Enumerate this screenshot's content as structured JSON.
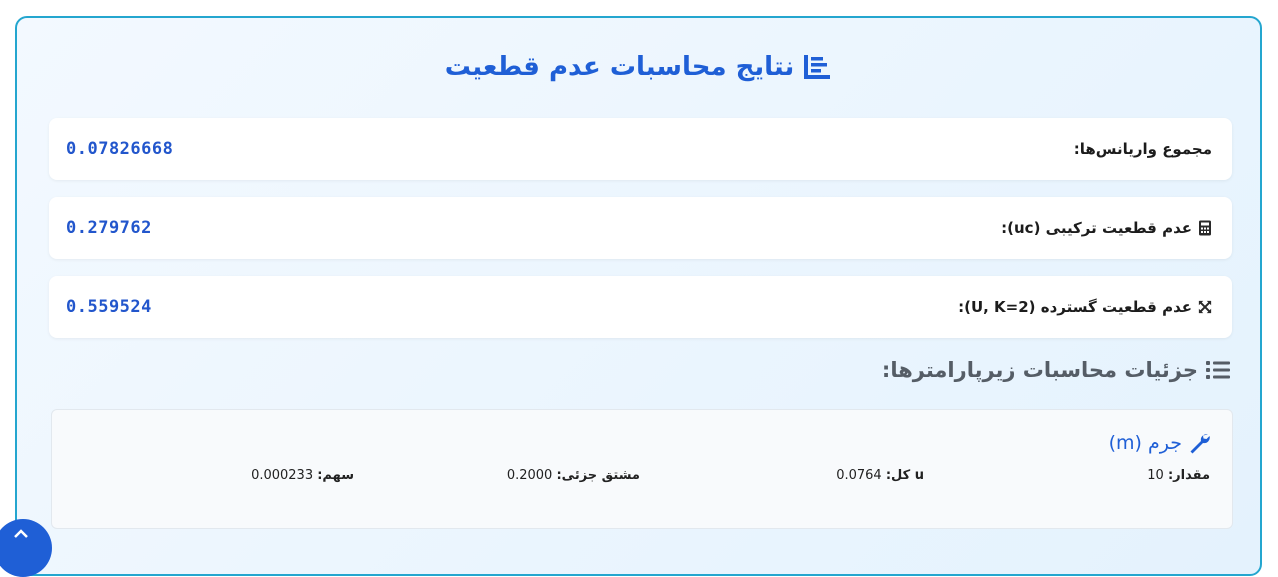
{
  "results": {
    "title": "نتایج محاسبات عدم قطعیت",
    "title_icon": "chart-list-icon",
    "sum_variance": {
      "label": "مجموع واریانس‌ها:",
      "value": "0.07826668"
    },
    "combined": {
      "label": "عدم قطعیت ترکیبی (uc):",
      "value": "0.279762",
      "icon": "calculator-icon"
    },
    "expanded": {
      "label": "عدم قطعیت گسترده (U, K=2):",
      "value": "0.559524",
      "icon": "expand-arrows-icon"
    }
  },
  "details": {
    "heading": "جزئیات محاسبات زیرپارامترها:",
    "heading_icon": "list-icon",
    "items": [
      {
        "name": "جرم (m)",
        "icon": "wrench-icon",
        "value_label": "مقدار:",
        "value": "10",
        "u_total_label": "u کل:",
        "u_total": "0.0764",
        "partial_label": "مشتق جزئی:",
        "partial": "0.2000",
        "share_label": "سهم:",
        "share": "0.000233"
      }
    ]
  },
  "fab": {
    "icon": "chevron-up-icon"
  },
  "colors": {
    "accent": "#1f5fd6",
    "border": "#24a6cf",
    "value": "#2256cc"
  }
}
